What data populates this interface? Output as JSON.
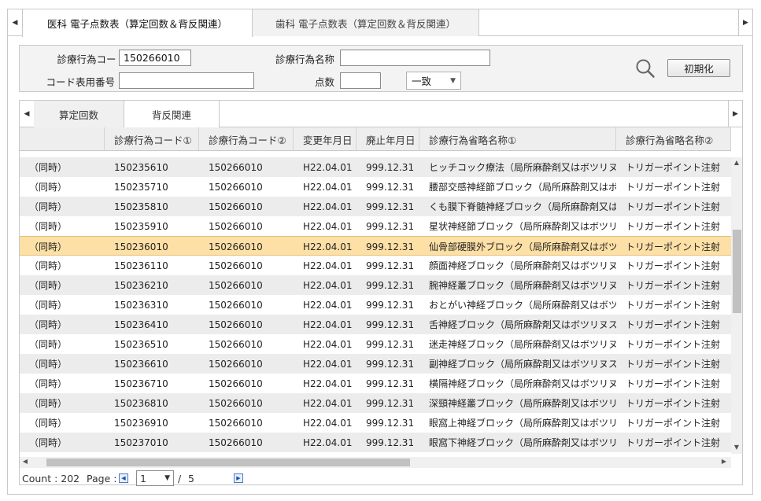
{
  "top_tabs": [
    {
      "label": "医科 電子点数表（算定回数＆背反関連）",
      "active": true
    },
    {
      "label": "歯科 電子点数表（算定回数＆背反関連）",
      "active": false
    }
  ],
  "search": {
    "code_label": "診療行為コード",
    "code_value": "150266010",
    "name_label": "診療行為名称",
    "name_value": "",
    "table_no_label": "コード表用番号",
    "table_no_value": "",
    "points_label": "点数",
    "points_value": "",
    "match_value": "一致",
    "reset_label": "初期化"
  },
  "sub_tabs": [
    {
      "label": "算定回数",
      "active": false
    },
    {
      "label": "背反関連",
      "active": true
    }
  ],
  "table": {
    "columns": [
      "",
      "診療行為コード①",
      "診療行為コード②",
      "変更年月日",
      "廃止年月日",
      "診療行為省略名称①",
      "診療行為省略名称②"
    ],
    "rows": [
      [
        "（同時）",
        "150235610",
        "150266010",
        "H22.04.01",
        "999.12.31",
        "ヒッチコック療法（局所麻酔剤又はボツリヌス毒素",
        "トリガーポイント注射"
      ],
      [
        "（同時）",
        "150235710",
        "150266010",
        "H22.04.01",
        "999.12.31",
        "腰部交感神経節ブロック（局所麻酔剤又はボツリヌ",
        "トリガーポイント注射"
      ],
      [
        "（同時）",
        "150235810",
        "150266010",
        "H22.04.01",
        "999.12.31",
        "くも膜下脊髄神経ブロック（局所麻酔剤又はボツリ",
        "トリガーポイント注射"
      ],
      [
        "（同時）",
        "150235910",
        "150266010",
        "H22.04.01",
        "999.12.31",
        "星状神経節ブロック（局所麻酔剤又はボツリヌス毒",
        "トリガーポイント注射"
      ],
      [
        "（同時）",
        "150236010",
        "150266010",
        "H22.04.01",
        "999.12.31",
        "仙骨部硬膜外ブロック（局所麻酔剤又はボツリヌス",
        "トリガーポイント注射"
      ],
      [
        "（同時）",
        "150236110",
        "150266010",
        "H22.04.01",
        "999.12.31",
        "顔面神経ブロック（局所麻酔剤又はボツリヌス毒素",
        "トリガーポイント注射"
      ],
      [
        "（同時）",
        "150236210",
        "150266010",
        "H22.04.01",
        "999.12.31",
        "腕神経叢ブロック（局所麻酔剤又はボツリヌス毒素",
        "トリガーポイント注射"
      ],
      [
        "（同時）",
        "150236310",
        "150266010",
        "H22.04.01",
        "999.12.31",
        "おとがい神経ブロック（局所麻酔剤又はボツリヌス",
        "トリガーポイント注射"
      ],
      [
        "（同時）",
        "150236410",
        "150266010",
        "H22.04.01",
        "999.12.31",
        "舌神経ブロック（局所麻酔剤又はボツリヌス毒素）",
        "トリガーポイント注射"
      ],
      [
        "（同時）",
        "150236510",
        "150266010",
        "H22.04.01",
        "999.12.31",
        "迷走神経ブロック（局所麻酔剤又はボツリヌス毒素",
        "トリガーポイント注射"
      ],
      [
        "（同時）",
        "150236610",
        "150266010",
        "H22.04.01",
        "999.12.31",
        "副神経ブロック（局所麻酔剤又はボツリヌス毒素）",
        "トリガーポイント注射"
      ],
      [
        "（同時）",
        "150236710",
        "150266010",
        "H22.04.01",
        "999.12.31",
        "横隔神経ブロック（局所麻酔剤又はボツリヌス毒素",
        "トリガーポイント注射"
      ],
      [
        "（同時）",
        "150236810",
        "150266010",
        "H22.04.01",
        "999.12.31",
        "深頸神経叢ブロック（局所麻酔剤又はボツリヌス毒",
        "トリガーポイント注射"
      ],
      [
        "（同時）",
        "150236910",
        "150266010",
        "H22.04.01",
        "999.12.31",
        "眼窩上神経ブロック（局所麻酔剤又はボツリヌス毒",
        "トリガーポイント注射"
      ],
      [
        "（同時）",
        "150237010",
        "150266010",
        "H22.04.01",
        "999.12.31",
        "眼窩下神経ブロック（局所麻酔剤又はボツリヌス毒",
        "トリガーポイント注射"
      ]
    ],
    "selected_row": 4
  },
  "footer": {
    "count_text": "Count : 202",
    "page_label": "Page :",
    "current_page": "1",
    "separator": "/",
    "total_pages": "5"
  },
  "icons": {
    "tab_left": "chevron-left-icon",
    "tab_right": "chevron-right-icon",
    "search": "magnifier-icon",
    "dropdown": "caret-down-icon"
  },
  "colors": {
    "selected_row": "#fde0a6",
    "header_bg": "#eeeeee",
    "stripe_bg": "#ececec",
    "panel_bg": "#f3f3f3"
  }
}
